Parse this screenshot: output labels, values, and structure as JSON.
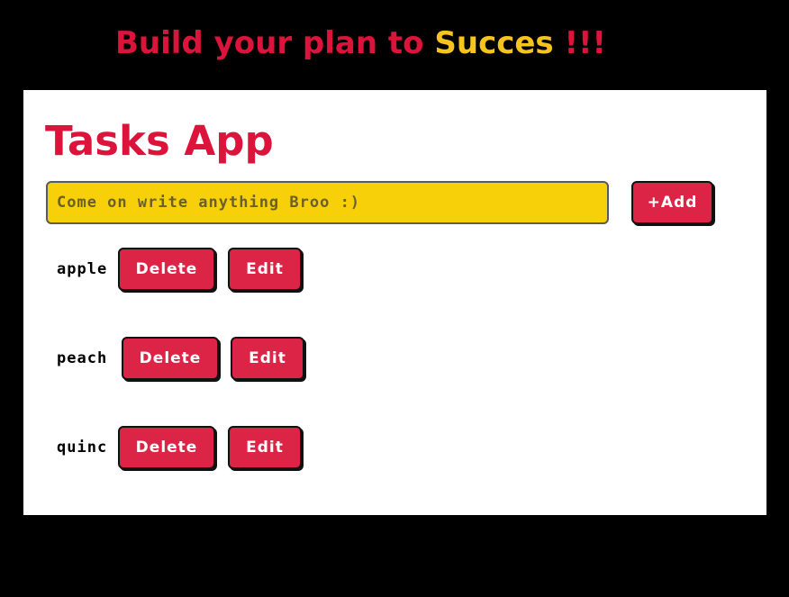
{
  "banner": {
    "part1": "Build your plan to ",
    "part2": "Succes",
    "part3": " !!!"
  },
  "app": {
    "title": "Tasks App",
    "input_placeholder": "Come on write anything Broo :)",
    "input_value": "",
    "add_label": "+Add"
  },
  "tasks": [
    {
      "name": "apple",
      "delete_label": "Delete",
      "edit_label": "Edit"
    },
    {
      "name": "peach",
      "delete_label": "Delete",
      "edit_label": "Edit"
    },
    {
      "name": "quinc",
      "delete_label": "Delete",
      "edit_label": "Edit"
    }
  ],
  "colors": {
    "page_background": "#000000",
    "headline_red": "#dc143c",
    "headline_yellow": "#f7c31e",
    "card_background": "#ffffff",
    "input_background": "#f7d009",
    "button_background": "#dc2446",
    "button_text": "#ffffff"
  }
}
